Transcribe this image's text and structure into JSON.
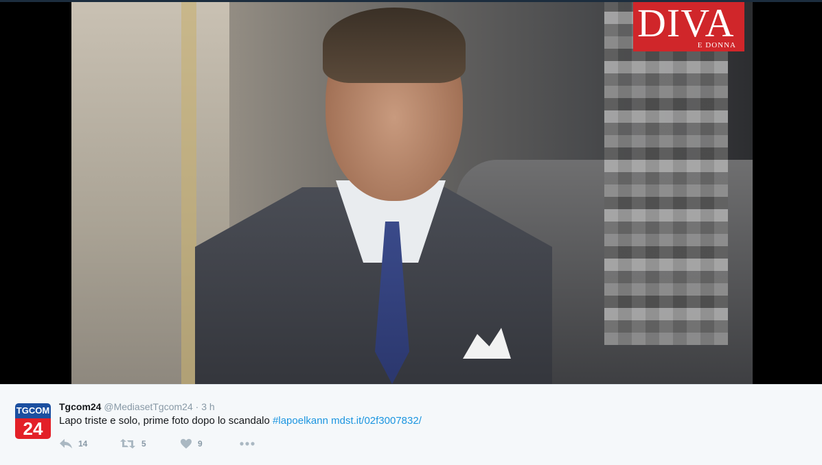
{
  "magazine": {
    "title": "DIVA",
    "subtitle": "E DONNA"
  },
  "tweet": {
    "avatar": {
      "top_text": "TGCOM",
      "bottom_text": "24"
    },
    "name": "Tgcom24",
    "handle": "@MediasetTgcom24",
    "separator": " · ",
    "time": "3 h",
    "text": "Lapo triste e solo, prime foto dopo lo scandalo ",
    "hashtag": "#lapoelkann",
    "link": "mdst.it/02f3007832/",
    "actions": {
      "reply_count": "14",
      "retweet_count": "5",
      "like_count": "9"
    }
  },
  "colors": {
    "link": "#1b95e0",
    "tweet_bg": "#f5f8fa",
    "brand_red": "#d0262a",
    "brand_blue": "#1b4fa0"
  },
  "icons": [
    "reply-icon",
    "retweet-icon",
    "like-icon",
    "more-icon"
  ]
}
